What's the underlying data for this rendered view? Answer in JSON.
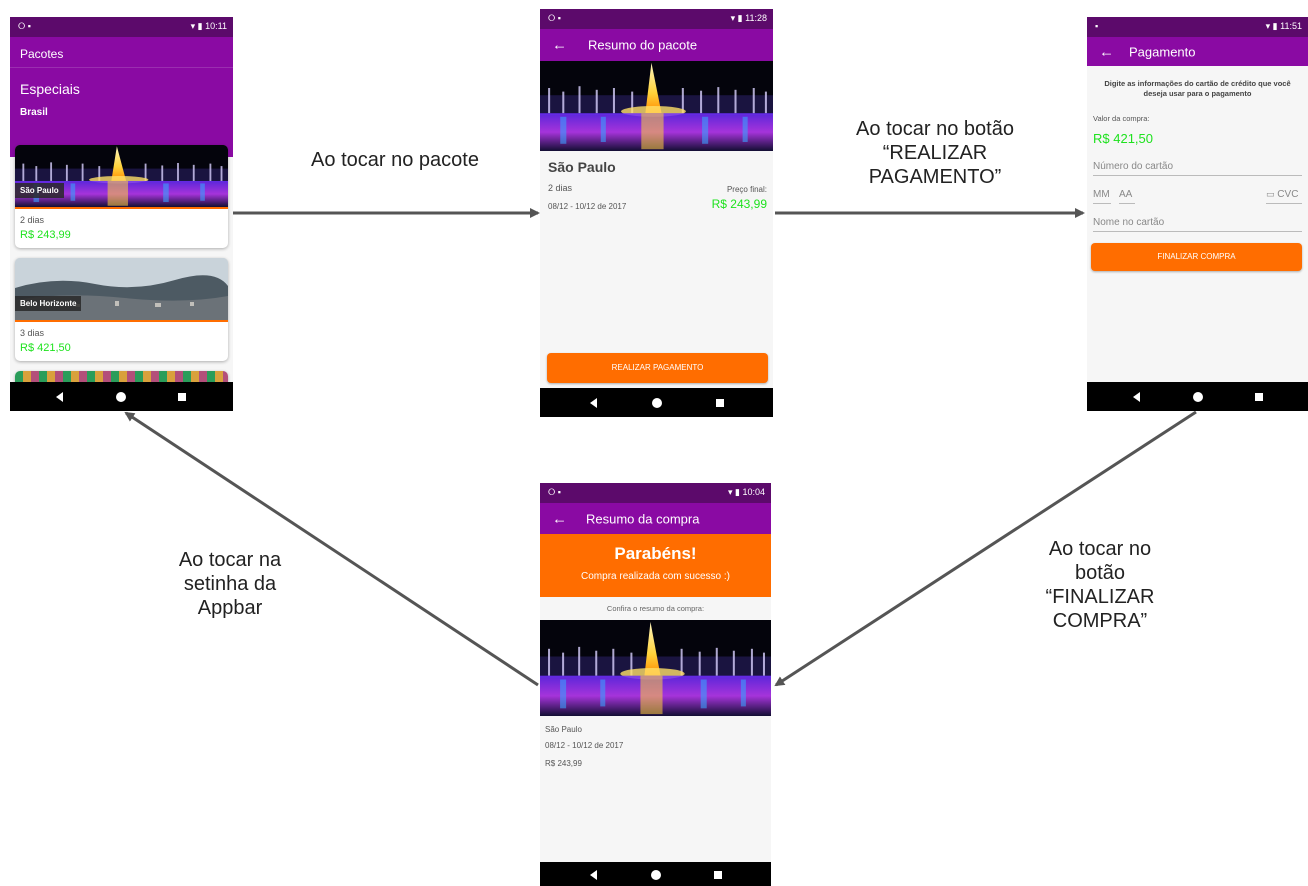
{
  "captions": {
    "tocar_pacote": [
      "Ao tocar no pacote"
    ],
    "tocar_realizar": [
      "Ao tocar no botão",
      "“REALIZAR",
      "PAGAMENTO”"
    ],
    "tocar_finalizar": [
      "Ao tocar no",
      "botão",
      "“FINALIZAR",
      "COMPRA”"
    ],
    "tocar_setinha": [
      "Ao tocar na",
      "setinha da",
      "Appbar"
    ]
  },
  "screen_pacotes": {
    "time": "10:11",
    "appbar_title": "Pacotes",
    "header_title": "Especiais",
    "header_subtitle": "Brasil",
    "packages": [
      {
        "place": "São Paulo",
        "days": "2 dias",
        "price": "R$ 243,99"
      },
      {
        "place": "Belo Horizonte",
        "days": "3 dias",
        "price": "R$ 421,50"
      }
    ]
  },
  "screen_resumo_pacote": {
    "time": "11:28",
    "appbar_title": "Resumo do pacote",
    "place": "São Paulo",
    "days": "2 dias",
    "dates": "08/12 - 10/12 de 2017",
    "price_label": "Preço final:",
    "price": "R$ 243,99",
    "button": "REALIZAR PAGAMENTO"
  },
  "screen_pagamento": {
    "time": "11:51",
    "appbar_title": "Pagamento",
    "instructions": "Digite as informações do cartão de crédito que você deseja usar para o pagamento",
    "valor_label": "Valor da compra:",
    "valor": "R$ 421,50",
    "card_number_placeholder": "Número do cartão",
    "month_placeholder": "MM",
    "year_placeholder": "AA",
    "cvc_placeholder": "CVC",
    "name_placeholder": "Nome no cartão",
    "button": "FINALIZAR COMPRA"
  },
  "screen_resumo_compra": {
    "time": "10:04",
    "appbar_title": "Resumo da compra",
    "congrats": "Parabéns!",
    "success_message": "Compra realizada com sucesso :)",
    "confira": "Confira o resumo da compra:",
    "place": "São Paulo",
    "dates": "08/12 - 10/12 de 2017",
    "price": "R$ 243,99"
  },
  "colors": {
    "purple": "#8a0aa3",
    "status_purple": "#5c0a6b",
    "orange": "#ff6d00",
    "price_green": "#1ee21e",
    "arrow": "#555555"
  }
}
